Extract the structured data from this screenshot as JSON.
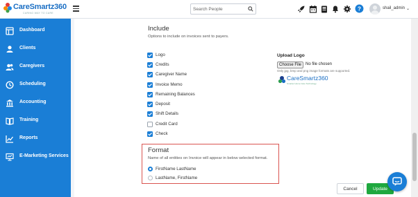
{
  "header": {
    "logo_text": "CareSmartz360",
    "logo_tagline": "CARING WAY TO CARE",
    "search_placeholder": "Search People",
    "username": "shail_admin",
    "icons": [
      "rocket-icon",
      "calendar-icon",
      "clipboard-icon",
      "bell-icon",
      "gear-icon",
      "help-icon",
      "avatar",
      "chevron-down-icon"
    ]
  },
  "sidebar": {
    "items": [
      {
        "label": "Dashboard",
        "icon": "dashboard-icon"
      },
      {
        "label": "Clients",
        "icon": "user-icon"
      },
      {
        "label": "Caregivers",
        "icon": "users-icon"
      },
      {
        "label": "Scheduling",
        "icon": "clock-icon"
      },
      {
        "label": "Accounting",
        "icon": "bank-icon"
      },
      {
        "label": "Training",
        "icon": "book-icon"
      },
      {
        "label": "Reports",
        "icon": "chart-icon"
      },
      {
        "label": "E-Marketing Services",
        "icon": "presentation-icon"
      }
    ]
  },
  "include": {
    "title": "Include",
    "subtitle": "Options to include on invoices sent to payers.",
    "options": [
      {
        "label": "Logo",
        "checked": true
      },
      {
        "label": "Credits",
        "checked": true
      },
      {
        "label": "Caregiver Name",
        "checked": true
      },
      {
        "label": "Invoice Memo",
        "checked": true
      },
      {
        "label": "Remaining Balances",
        "checked": true
      },
      {
        "label": "Deposit",
        "checked": true
      },
      {
        "label": "Shift Details",
        "checked": true
      },
      {
        "label": "Credit Card",
        "checked": false
      },
      {
        "label": "Check",
        "checked": true
      }
    ]
  },
  "upload_logo": {
    "title": "Upload Logo",
    "choose_button": "Choose File",
    "file_status": "No file chosen",
    "hint": "Only jpg, bmp and png image formats are supported.",
    "preview_text": "CareSmartz360",
    "preview_tagline": "Smarter Home Care Technology"
  },
  "format": {
    "title": "Format",
    "subtitle": "Name of all entities on Invoice will appear in below selected format.",
    "options": [
      {
        "label": "FirstName LastName",
        "selected": true
      },
      {
        "label": "LastName, FirstName",
        "selected": false
      }
    ]
  },
  "actions": {
    "cancel": "Cancel",
    "update": "Update"
  },
  "colors": {
    "sidebar": "#1a7ed6",
    "primary": "#1a7ed6",
    "update_button": "#1fa83f",
    "highlight_border": "#d9534f"
  }
}
